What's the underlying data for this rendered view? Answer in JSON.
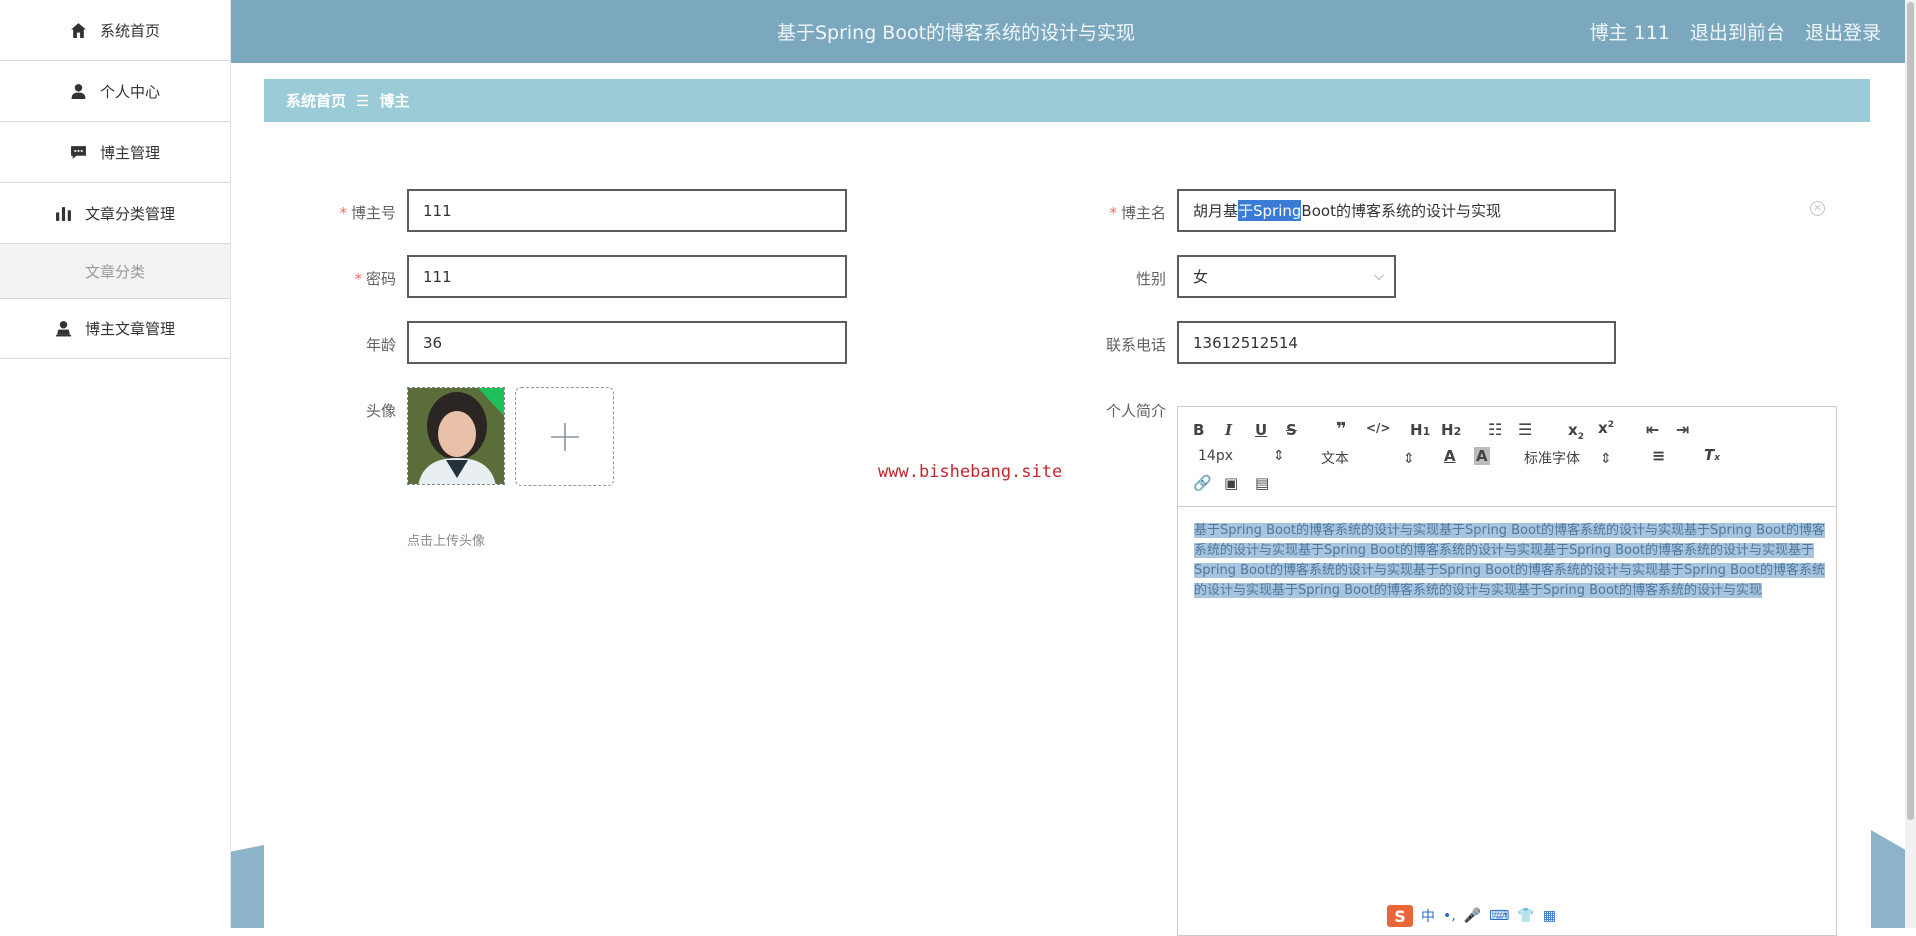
{
  "header": {
    "title": "基于Spring Boot的博客系统的设计与实现",
    "user": "博主 111",
    "to_front": "退出到前台",
    "logout": "退出登录"
  },
  "sidebar": {
    "items": [
      {
        "label": "系统首页",
        "icon": "home-icon"
      },
      {
        "label": "个人中心",
        "icon": "user-icon"
      },
      {
        "label": "博主管理",
        "icon": "chat-icon"
      },
      {
        "label": "文章分类管理",
        "icon": "bar-chart-icon"
      },
      {
        "label": "文章分类",
        "icon": ""
      },
      {
        "label": "博主文章管理",
        "icon": "person-icon"
      }
    ]
  },
  "breadcrumb": {
    "home": "系统首页",
    "sep": "☰",
    "current": "博主"
  },
  "form": {
    "account_label": "博主号",
    "account_value": "111",
    "name_label": "博主名",
    "name_prefix": "胡月基",
    "name_selected": "于Spring",
    "name_suffix": " Boot的博客系统的设计与实现",
    "password_label": "密码",
    "password_value": "111",
    "gender_label": "性别",
    "gender_value": "女",
    "age_label": "年龄",
    "age_value": "36",
    "phone_label": "联系电话",
    "phone_value": "13612512514",
    "avatar_label": "头像",
    "avatar_hint": "点击上传头像",
    "bio_label": "个人简介"
  },
  "watermark": "www.bishebang.site",
  "editor": {
    "size": "14px",
    "type": "文本",
    "font": "标准字体",
    "content": "基于Spring Boot的博客系统的设计与实现基于Spring Boot的博客系统的设计与实现基于Spring Boot的博客系统的设计与实现基于Spring Boot的博客系统的设计与实现基于Spring Boot的博客系统的设计与实现基于Spring Boot的博客系统的设计与实现基于Spring Boot的博客系统的设计与实现基于Spring Boot的博客系统的设计与实现基于Spring Boot的博客系统的设计与实现基于Spring Boot的博客系统的设计与实现"
  },
  "ime": {
    "logo": "S",
    "lang": "中"
  }
}
